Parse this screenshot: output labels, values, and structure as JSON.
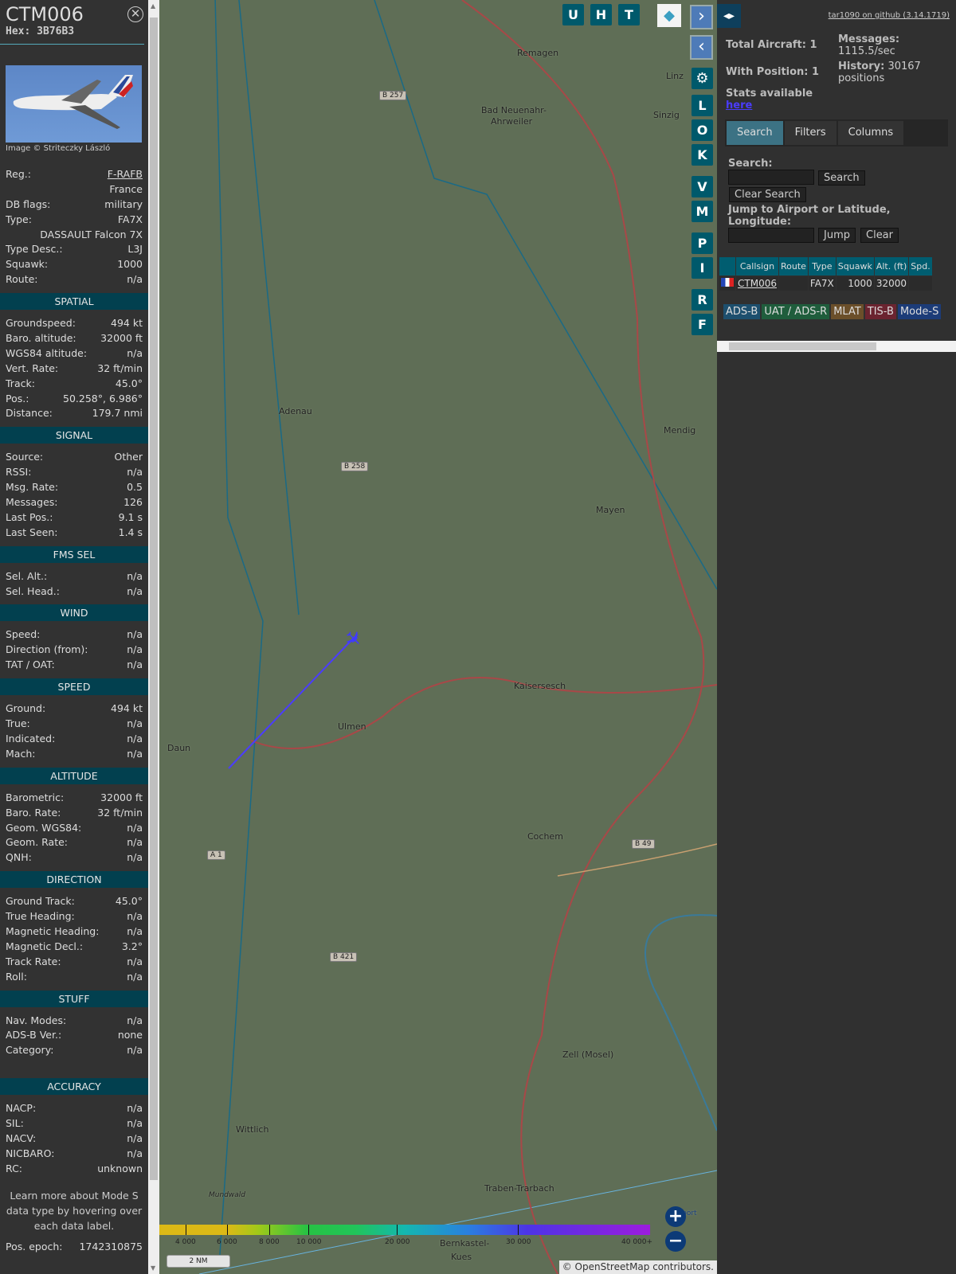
{
  "aircraft": {
    "callsign": "CTM006",
    "hex_label": "Hex:",
    "hex": "3B76B3",
    "photo_credit": "Image © Striteczky László"
  },
  "info": [
    {
      "type": "row",
      "label": "Reg.:",
      "value": "F-RAFB",
      "link": true
    },
    {
      "type": "row",
      "label": "",
      "value": "France"
    },
    {
      "type": "row",
      "label": "DB flags:",
      "value": "military"
    },
    {
      "type": "row",
      "label": "Type:",
      "value": "FA7X"
    },
    {
      "type": "row",
      "label": "",
      "value": "DASSAULT Falcon 7X"
    },
    {
      "type": "row",
      "label": "Type Desc.:",
      "value": "L3J"
    },
    {
      "type": "row",
      "label": "Squawk:",
      "value": "1000"
    },
    {
      "type": "row",
      "label": "Route:",
      "value": "n/a"
    },
    {
      "type": "sec",
      "label": "SPATIAL"
    },
    {
      "type": "row",
      "label": "Groundspeed:",
      "value": "494 kt"
    },
    {
      "type": "row",
      "label": "Baro. altitude:",
      "value": "32000 ft"
    },
    {
      "type": "row",
      "label": "WGS84 altitude:",
      "value": "n/a"
    },
    {
      "type": "row",
      "label": "Vert. Rate:",
      "value": "32 ft/min"
    },
    {
      "type": "row",
      "label": "Track:",
      "value": "45.0°"
    },
    {
      "type": "row",
      "label": "Pos.:",
      "value": "50.258°, 6.986°"
    },
    {
      "type": "row",
      "label": "Distance:",
      "value": "179.7 nmi"
    },
    {
      "type": "sec",
      "label": "SIGNAL"
    },
    {
      "type": "row",
      "label": "Source:",
      "value": "Other"
    },
    {
      "type": "row",
      "label": "RSSI:",
      "value": "n/a"
    },
    {
      "type": "row",
      "label": "Msg. Rate:",
      "value": "0.5"
    },
    {
      "type": "row",
      "label": "Messages:",
      "value": "126"
    },
    {
      "type": "row",
      "label": "Last Pos.:",
      "value": "9.1 s"
    },
    {
      "type": "row",
      "label": "Last Seen:",
      "value": "1.4 s"
    },
    {
      "type": "sec",
      "label": "FMS SEL"
    },
    {
      "type": "row",
      "label": "Sel. Alt.:",
      "value": "n/a"
    },
    {
      "type": "row",
      "label": "Sel. Head.:",
      "value": "n/a"
    },
    {
      "type": "sec",
      "label": "WIND"
    },
    {
      "type": "row",
      "label": "Speed:",
      "value": "n/a"
    },
    {
      "type": "row",
      "label": "Direction (from):",
      "value": "n/a"
    },
    {
      "type": "row",
      "label": "TAT / OAT:",
      "value": "n/a"
    },
    {
      "type": "sec",
      "label": "SPEED"
    },
    {
      "type": "row",
      "label": "Ground:",
      "value": "494 kt"
    },
    {
      "type": "row",
      "label": "True:",
      "value": "n/a"
    },
    {
      "type": "row",
      "label": "Indicated:",
      "value": "n/a"
    },
    {
      "type": "row",
      "label": "Mach:",
      "value": "n/a"
    },
    {
      "type": "sec",
      "label": "ALTITUDE"
    },
    {
      "type": "row",
      "label": "Barometric:",
      "value": "32000 ft"
    },
    {
      "type": "row",
      "label": "Baro. Rate:",
      "value": "32 ft/min"
    },
    {
      "type": "row",
      "label": "Geom. WGS84:",
      "value": "n/a"
    },
    {
      "type": "row",
      "label": "Geom. Rate:",
      "value": "n/a"
    },
    {
      "type": "row",
      "label": "QNH:",
      "value": "n/a"
    },
    {
      "type": "sec",
      "label": "DIRECTION"
    },
    {
      "type": "row",
      "label": "Ground Track:",
      "value": "45.0°"
    },
    {
      "type": "row",
      "label": "True Heading:",
      "value": "n/a"
    },
    {
      "type": "row",
      "label": "Magnetic Heading:",
      "value": "n/a"
    },
    {
      "type": "row",
      "label": "Magnetic Decl.:",
      "value": "3.2°"
    },
    {
      "type": "row",
      "label": "Track Rate:",
      "value": "n/a"
    },
    {
      "type": "row",
      "label": "Roll:",
      "value": "n/a"
    },
    {
      "type": "sec",
      "label": "STUFF"
    },
    {
      "type": "row",
      "label": "Nav. Modes:",
      "value": "n/a"
    },
    {
      "type": "row",
      "label": "ADS-B Ver.:",
      "value": "none"
    },
    {
      "type": "row",
      "label": "Category:",
      "value": "n/a"
    },
    {
      "type": "gap"
    },
    {
      "type": "sec",
      "label": "ACCURACY"
    },
    {
      "type": "row",
      "label": "NACP:",
      "value": "n/a"
    },
    {
      "type": "row",
      "label": "SIL:",
      "value": "n/a"
    },
    {
      "type": "row",
      "label": "NACV:",
      "value": "n/a"
    },
    {
      "type": "row",
      "label": "NICBARO:",
      "value": "n/a"
    },
    {
      "type": "row",
      "label": "RC:",
      "value": "unknown"
    },
    {
      "type": "note",
      "label": "Learn more about Mode S data type by hovering over each data label."
    },
    {
      "type": "row",
      "label": "Pos. epoch:",
      "value": "1742310875"
    }
  ],
  "map": {
    "buttons": [
      "U",
      "H",
      "T"
    ],
    "side_buttons": [
      "L",
      "O",
      "K",
      "V",
      "M",
      "P",
      "I",
      "R",
      "F"
    ],
    "labels": [
      "Remagen",
      "Bad Neuenahr-",
      "Ahrweiler",
      "Linz",
      "Sinzig",
      "Adenau",
      "Mayen",
      "Kaisersesch",
      "Ulmen",
      "Daun",
      "Cochem",
      "Zell (Mosel)",
      "Wittlich",
      "Mundwald",
      "Traben-Trarbach",
      "Bernkastel-",
      "Kues",
      "Mendig",
      "Ho   port"
    ],
    "roads": [
      "B 257",
      "B 258",
      "B 49",
      "A 1",
      "B 421"
    ],
    "altitude_legend": [
      "4 000",
      "6 000",
      "8 000",
      "10 000",
      "20 000",
      "30 000",
      "40 000+"
    ],
    "scale": "2 NM",
    "attribution": "© OpenStreetMap contributors."
  },
  "right": {
    "github": "tar1090 on github (3.14.1719)",
    "total_aircraft": "Total Aircraft: 1",
    "with_position": "With Position: 1",
    "messages_label": "Messages:",
    "messages": "1115.5/sec",
    "history_label": "History:",
    "history": "30167 positions",
    "stats": "Stats available",
    "stats_link": "here",
    "tabs": [
      "Search",
      "Filters",
      "Columns"
    ],
    "search_label": "Search:",
    "search_btn": "Search",
    "clear_search": "Clear Search",
    "jump_label": "Jump to Airport or Latitude, Longitude:",
    "jump_btn": "Jump",
    "clear_btn": "Clear",
    "table": {
      "headers": [
        "",
        "Callsign",
        "Route",
        "Type",
        "Squawk",
        "Alt. (ft)",
        "Spd."
      ],
      "rows": [
        {
          "callsign": "CTM006",
          "route": "",
          "type": "FA7X",
          "squawk": "1000",
          "alt": "32000",
          "spd": ""
        }
      ]
    },
    "legend": [
      {
        "label": "ADS-B",
        "color": "#1d4f6e"
      },
      {
        "label": "UAT / ADS-R",
        "color": "#1f5d3c"
      },
      {
        "label": "MLAT",
        "color": "#6b4f2a"
      },
      {
        "label": "TIS-B",
        "color": "#6b2430"
      },
      {
        "label": "Mode-S",
        "color": "#1c3c78"
      }
    ]
  }
}
